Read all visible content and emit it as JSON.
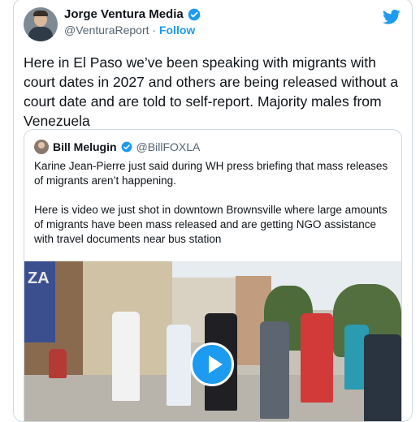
{
  "tweet": {
    "author_name": "Jorge Ventura Media",
    "author_handle": "@VenturaReport",
    "separator": "·",
    "follow_label": "Follow",
    "text": "Here in El Paso we’ve been speaking with migrants with court dates in 2027 and others are being released without a court date and are told to self-report. Majority males from Venezuela"
  },
  "quote": {
    "author_name": "Bill Melugin",
    "author_handle": "@BillFOXLA",
    "paragraph1": "Karine Jean-Pierre just said during WH press briefing that mass releases of migrants aren’t happening.",
    "paragraph2": "Here is video we just shot in downtown Brownsville where large amounts of migrants have been mass released and are getting NGO assistance with travel documents near bus station"
  },
  "video": {
    "sign_text": "ZA"
  },
  "icons": {
    "verified": "verified-badge-icon",
    "brand": "twitter-bird-icon",
    "play": "play-icon"
  },
  "colors": {
    "accent": "#1d9bf0",
    "text": "#0f1419",
    "secondary": "#536471",
    "border": "#cfd9de"
  }
}
